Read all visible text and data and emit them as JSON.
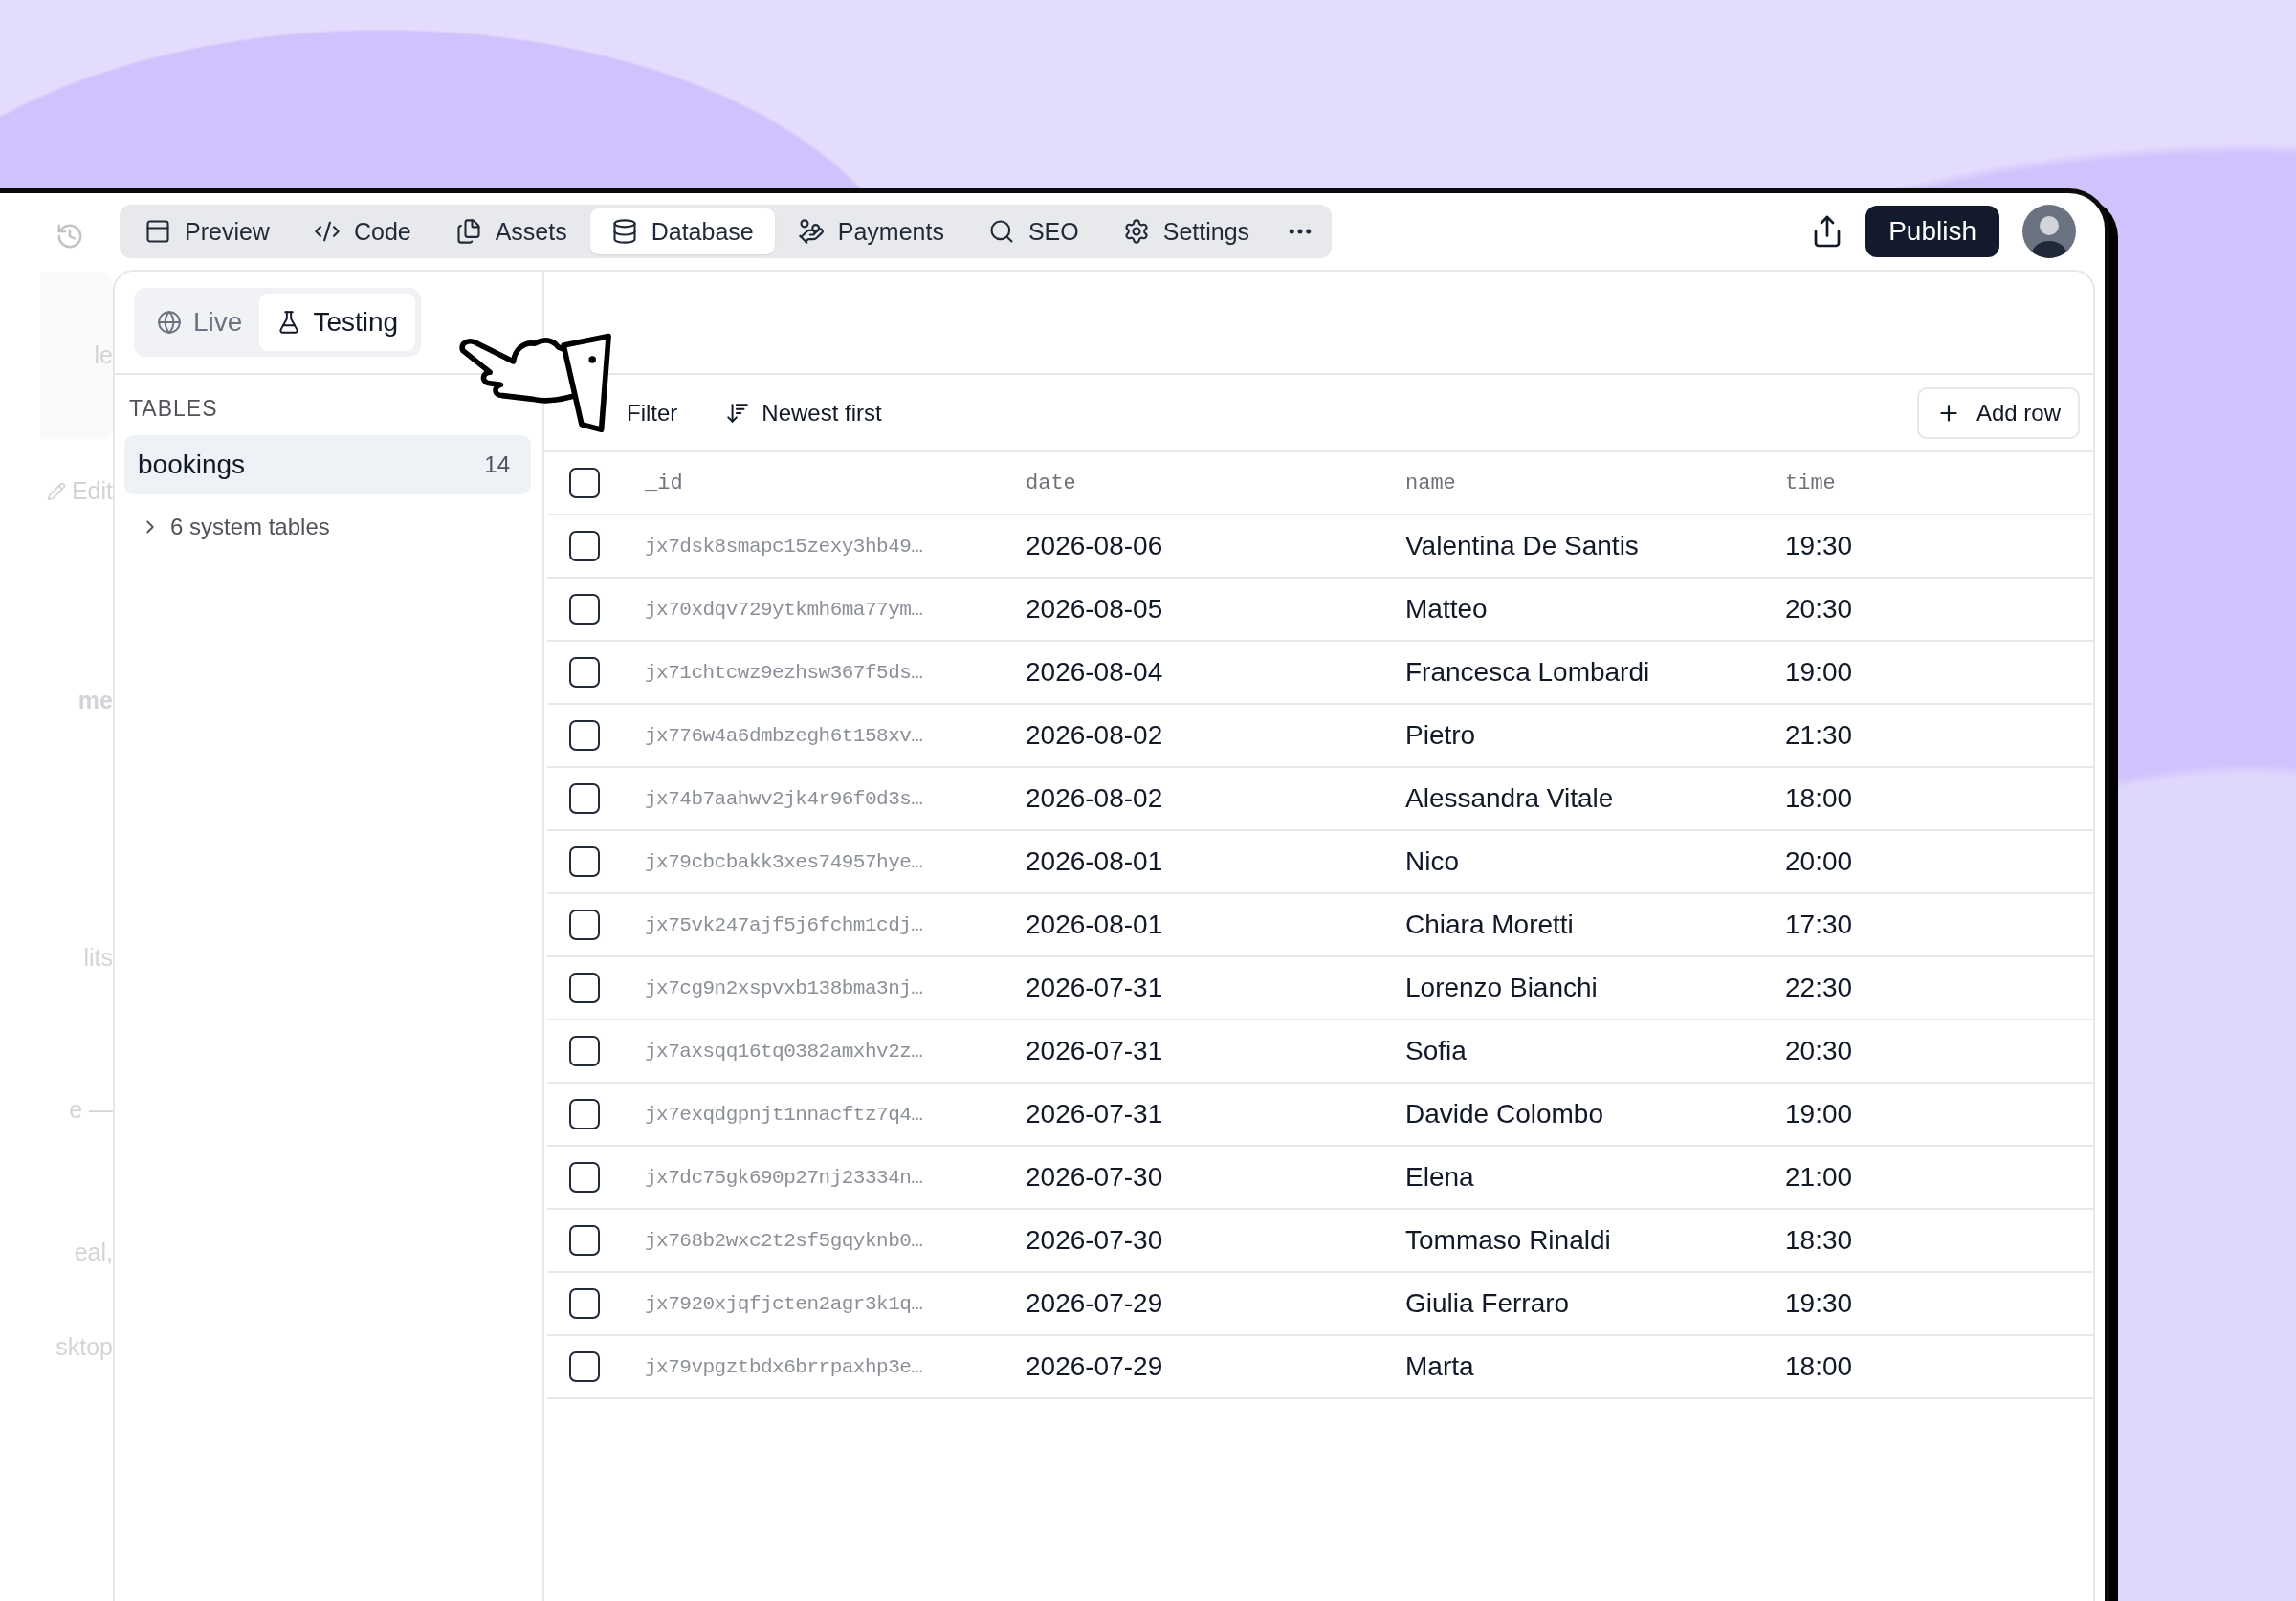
{
  "background_panel": {
    "texts": [
      "le",
      "Edit",
      "me",
      "lits",
      "e —",
      "eal,",
      "sktop"
    ]
  },
  "toolbar": {
    "tabs": [
      {
        "label": "Preview",
        "selected": false
      },
      {
        "label": "Code",
        "selected": false
      },
      {
        "label": "Assets",
        "selected": false
      },
      {
        "label": "Database",
        "selected": true
      },
      {
        "label": "Payments",
        "selected": false
      },
      {
        "label": "SEO",
        "selected": false
      },
      {
        "label": "Settings",
        "selected": false
      }
    ],
    "publish": "Publish"
  },
  "environment_tabs": [
    {
      "label": "Live",
      "selected": false
    },
    {
      "label": "Testing",
      "selected": true
    }
  ],
  "sidebar": {
    "heading": "TABLES",
    "tables": [
      {
        "name": "bookings",
        "count": "14",
        "selected": true
      }
    ],
    "system_tables": {
      "label": "6 system tables",
      "expanded": false
    }
  },
  "table_toolbar": {
    "filter": "Filter",
    "sort": "Newest first",
    "add_row": "Add row"
  },
  "table": {
    "all_checked": false,
    "columns": [
      "_id",
      "date",
      "name",
      "time"
    ],
    "rows": [
      {
        "checked": false,
        "cells": [
          "jx7dsk8smapc15zexy3hb49…",
          "2026-08-06",
          "Valentina De Santis",
          "19:30"
        ]
      },
      {
        "checked": false,
        "cells": [
          "jx70xdqv729ytkmh6ma77ym…",
          "2026-08-05",
          "Matteo",
          "20:30"
        ]
      },
      {
        "checked": false,
        "cells": [
          "jx71chtcwz9ezhsw367f5ds…",
          "2026-08-04",
          "Francesca Lombardi",
          "19:00"
        ]
      },
      {
        "checked": false,
        "cells": [
          "jx776w4a6dmbzegh6t158xv…",
          "2026-08-02",
          "Pietro",
          "21:30"
        ]
      },
      {
        "checked": false,
        "cells": [
          "jx74b7aahwv2jk4r96f0d3s…",
          "2026-08-02",
          "Alessandra Vitale",
          "18:00"
        ]
      },
      {
        "checked": false,
        "cells": [
          "jx79cbcbakk3xes74957hye…",
          "2026-08-01",
          "Nico",
          "20:00"
        ]
      },
      {
        "checked": false,
        "cells": [
          "jx75vk247ajf5j6fchm1cdj…",
          "2026-08-01",
          "Chiara Moretti",
          "17:30"
        ]
      },
      {
        "checked": false,
        "cells": [
          "jx7cg9n2xspvxb138bma3nj…",
          "2026-07-31",
          "Lorenzo Bianchi",
          "22:30"
        ]
      },
      {
        "checked": false,
        "cells": [
          "jx7axsqq16tq0382amxhv2z…",
          "2026-07-31",
          "Sofia",
          "20:30"
        ]
      },
      {
        "checked": false,
        "cells": [
          "jx7exqdgpnjt1nnacftz7q4…",
          "2026-07-31",
          "Davide Colombo",
          "19:00"
        ]
      },
      {
        "checked": false,
        "cells": [
          "jx7dc75gk690p27nj23334n…",
          "2026-07-30",
          "Elena",
          "21:00"
        ]
      },
      {
        "checked": false,
        "cells": [
          "jx768b2wxc2t2sf5gqyknb0…",
          "2026-07-30",
          "Tommaso Rinaldi",
          "18:30"
        ]
      },
      {
        "checked": false,
        "cells": [
          "jx7920xjqfjcten2agr3k1q…",
          "2026-07-29",
          "Giulia Ferraro",
          "19:30"
        ]
      },
      {
        "checked": false,
        "cells": [
          "jx79vpgztbdx6brrpaxhp3e…",
          "2026-07-29",
          "Marta",
          "18:00"
        ]
      }
    ]
  }
}
